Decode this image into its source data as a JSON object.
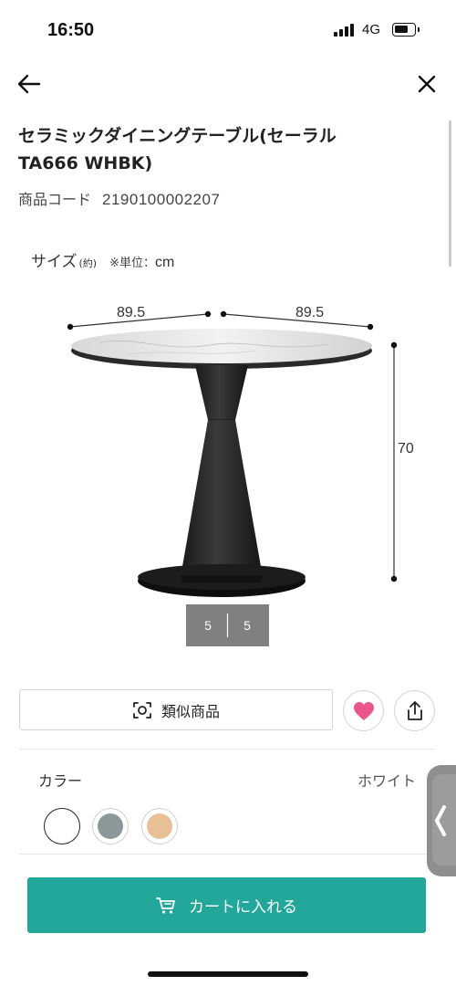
{
  "status_bar": {
    "time": "16:50",
    "network": "4G",
    "battery_level": 0.75
  },
  "nav": {
    "back_icon": "arrow-left-icon",
    "close_icon": "close-icon"
  },
  "product": {
    "title": "セラミックダイニングテーブル(セーラル TA666 WHBK)",
    "code_label": "商品コード",
    "code_value": "2190100002207"
  },
  "size_section": {
    "label": "サイズ",
    "approx": "(約)",
    "unit_label": "※単位：",
    "unit_value": "cm",
    "dimensions": {
      "width_left": "89.5",
      "width_right": "89.5",
      "height": "70",
      "base_left": "5",
      "base_right": "5"
    }
  },
  "actions": {
    "similar_label": "類似商品",
    "similar_icon": "camera-scan-icon",
    "favorite_icon": "heart-icon",
    "share_icon": "share-icon"
  },
  "color_section": {
    "label": "カラー",
    "selected_name": "ホワイト",
    "swatches": [
      {
        "name": "white",
        "color": "#ffffff"
      },
      {
        "name": "gray",
        "color": "#8c9799"
      },
      {
        "name": "beige",
        "color": "#e8bf96"
      }
    ]
  },
  "side_tab": {
    "icon": "chevron-left-icon"
  },
  "cart": {
    "label": "カートに入れる",
    "icon": "cart-icon",
    "color": "#23a79a"
  },
  "colors": {
    "accent": "#23a79a",
    "heart": "#e8568a"
  }
}
